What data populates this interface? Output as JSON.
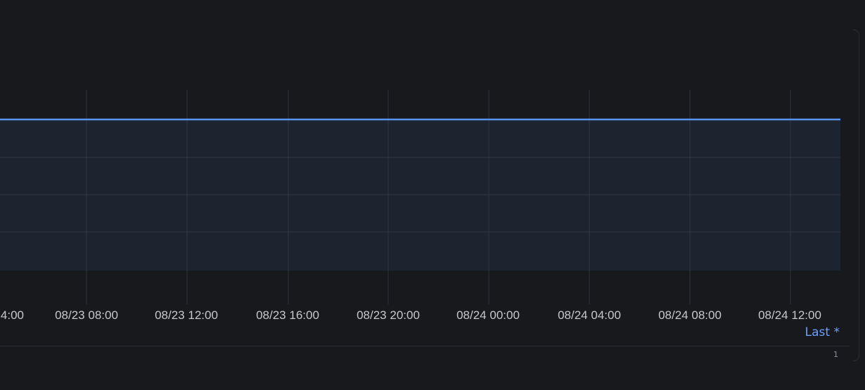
{
  "panel": {
    "legend_stat_label": "Last *",
    "footer_mark": "1"
  },
  "colors": {
    "background": "#18191d",
    "grid": "#2f3440",
    "series_line": "#5794f2",
    "series_fill": "#1c2430",
    "tick_text": "#c7c8cc",
    "legend_text": "#6e9fff"
  },
  "chart_data": {
    "type": "area",
    "x_tick_labels": [
      "4:00",
      "08/23 08:00",
      "08/23 12:00",
      "08/23 16:00",
      "08/23 20:00",
      "08/24 00:00",
      "08/24 04:00",
      "08/24 08:00",
      "08/24 12:00"
    ],
    "series": [
      {
        "points": [
          {
            "x": "4:00",
            "y": 1
          },
          {
            "x": "08/24 12:00",
            "y": 1
          }
        ]
      }
    ],
    "grid": true,
    "legend_position": "bottom-right"
  }
}
